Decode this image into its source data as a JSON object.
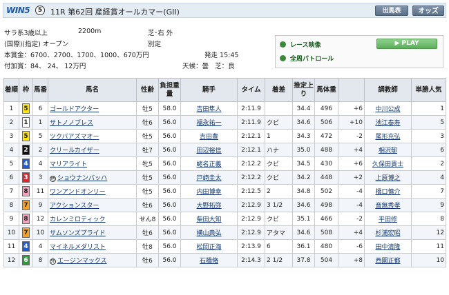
{
  "header": {
    "logo_text": "WIN5",
    "logo_number": "5",
    "race_title": "11R 第62回 産経賞オールカマー(GII)",
    "entry_button": "出馬表",
    "odds_button": "オッズ"
  },
  "race_info": {
    "class": "サラ系3歳以上",
    "distance": "2200m",
    "course": "芝･右 外",
    "conditions": "(国際)(指定) オープン",
    "weight_rule": "別定",
    "prize_label": "本賞金：",
    "prize": "6700、2700、1700、1000、670万円",
    "start_label": "発走",
    "start_time": "15:45",
    "added_label": "付加賞：",
    "added_prize": "84、 24、 12万円",
    "weather_label": "天候：",
    "weather": "曇",
    "track_label": "芝：",
    "track": "良"
  },
  "video_panel": {
    "race_video": "レース映像",
    "patrol": "全周パトロール",
    "play": "PLAY"
  },
  "table": {
    "headers": [
      "着順",
      "枠",
      "馬番",
      "馬名",
      "性齢",
      "負担重量",
      "騎手",
      "タイム",
      "着差",
      "推定上り",
      "馬体重",
      "",
      "調教師",
      "単勝人気"
    ],
    "rows": [
      {
        "rank": "1",
        "frame": "5",
        "num": "6",
        "mark": "",
        "horse": "ゴールドアクター",
        "sex_age": "牡5",
        "weight": "58.0",
        "jockey": "吉田隼人",
        "time": "2:11.9",
        "margin": "",
        "last3f": "34.4",
        "body": "496",
        "diff": "+6",
        "trainer": "中川公成",
        "pop": "1"
      },
      {
        "rank": "2",
        "frame": "1",
        "num": "1",
        "mark": "",
        "horse": "サトノノブレス",
        "sex_age": "牡6",
        "weight": "56.0",
        "jockey": "福永祐一",
        "time": "2:11.9",
        "margin": "クビ",
        "last3f": "34.6",
        "body": "506",
        "diff": "+10",
        "trainer": "池江泰寿",
        "pop": "5"
      },
      {
        "rank": "3",
        "frame": "5",
        "num": "5",
        "mark": "",
        "horse": "ツクバアズマオー",
        "sex_age": "牡5",
        "weight": "56.0",
        "jockey": "吉田豊",
        "time": "2:12.1",
        "margin": "1",
        "last3f": "34.3",
        "body": "472",
        "diff": "-2",
        "trainer": "尾形充弘",
        "pop": "3"
      },
      {
        "rank": "4",
        "frame": "2",
        "num": "2",
        "mark": "",
        "horse": "クリールカイザー",
        "sex_age": "牡7",
        "weight": "56.0",
        "jockey": "田辺裕信",
        "time": "2:12.1",
        "margin": "ハナ",
        "last3f": "35.0",
        "body": "488",
        "diff": "+4",
        "trainer": "相沢郁",
        "pop": "6"
      },
      {
        "rank": "5",
        "frame": "4",
        "num": "4",
        "mark": "",
        "horse": "マリアライト",
        "sex_age": "牝5",
        "weight": "56.0",
        "jockey": "蛯名正義",
        "time": "2:12.2",
        "margin": "クビ",
        "last3f": "34.5",
        "body": "430",
        "diff": "+6",
        "trainer": "久保田貴士",
        "pop": "2"
      },
      {
        "rank": "6",
        "frame": "3",
        "num": "3",
        "mark": "地",
        "horse": "ショウナンバッハ",
        "sex_age": "牡5",
        "weight": "56.0",
        "jockey": "戸崎圭太",
        "time": "2:12.2",
        "margin": "クビ",
        "last3f": "34.2",
        "body": "448",
        "diff": "+2",
        "trainer": "上原博之",
        "pop": "4"
      },
      {
        "rank": "7",
        "frame": "8",
        "num": "11",
        "mark": "",
        "horse": "ワンアンドオンリー",
        "sex_age": "牡5",
        "weight": "56.0",
        "jockey": "内田博幸",
        "time": "2:12.5",
        "margin": "2",
        "last3f": "34.8",
        "body": "502",
        "diff": "-4",
        "trainer": "橋口慎介",
        "pop": "7"
      },
      {
        "rank": "8",
        "frame": "7",
        "num": "9",
        "mark": "",
        "horse": "アクションスター",
        "sex_age": "牡6",
        "weight": "56.0",
        "jockey": "大野拓弥",
        "time": "2:12.9",
        "margin": "3 1/2",
        "last3f": "34.6",
        "body": "498",
        "diff": "-4",
        "trainer": "音無秀孝",
        "pop": "9"
      },
      {
        "rank": "9",
        "frame": "8",
        "num": "12",
        "mark": "",
        "horse": "カレンミロティック",
        "sex_age": "せん8",
        "weight": "56.0",
        "jockey": "柴田大知",
        "time": "2:12.9",
        "margin": "クビ",
        "last3f": "35.1",
        "body": "466",
        "diff": "-2",
        "trainer": "平田修",
        "pop": "8"
      },
      {
        "rank": "10",
        "frame": "7",
        "num": "10",
        "mark": "",
        "horse": "サムソンズプライド",
        "sex_age": "牡6",
        "weight": "56.0",
        "jockey": "横山典弘",
        "time": "2:12.9",
        "margin": "アタマ",
        "last3f": "34.6",
        "body": "508",
        "diff": "+4",
        "trainer": "杉浦宏昭",
        "pop": "12"
      },
      {
        "rank": "11",
        "frame": "4",
        "num": "4",
        "mark": "",
        "horse": "マイネルメダリスト",
        "sex_age": "牡8",
        "weight": "56.0",
        "jockey": "松岡正海",
        "time": "2:13.9",
        "margin": "6",
        "last3f": "36.1",
        "body": "480",
        "diff": "-6",
        "trainer": "田中清隆",
        "pop": "11"
      },
      {
        "rank": "12",
        "frame": "6",
        "num": "8",
        "mark": "外",
        "horse": "エージンマックス",
        "sex_age": "牡6",
        "weight": "56.0",
        "jockey": "石橋脩",
        "time": "2:14.3",
        "margin": "2 1/2",
        "last3f": "37.8",
        "body": "504",
        "diff": "+8",
        "trainer": "西園正都",
        "pop": "10"
      }
    ]
  },
  "frame_colors": {
    "1": {
      "bg": "#ffffff",
      "fg": "#222222"
    },
    "2": {
      "bg": "#111111",
      "fg": "#ffffff"
    },
    "3": {
      "bg": "#e6232d",
      "fg": "#ffffff"
    },
    "4": {
      "bg": "#1f5bd6",
      "fg": "#ffffff"
    },
    "5": {
      "bg": "#ffe600",
      "fg": "#222222"
    },
    "6": {
      "bg": "#2e9b3a",
      "fg": "#ffffff"
    },
    "7": {
      "bg": "#f7a11a",
      "fg": "#222222"
    },
    "8": {
      "bg": "#f6a4bd",
      "fg": "#222222"
    }
  }
}
